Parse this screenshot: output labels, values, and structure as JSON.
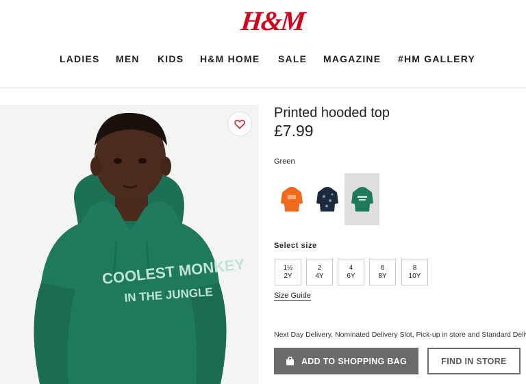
{
  "brand": {
    "logo_text": "H&M",
    "logo_color": "#d6001c"
  },
  "nav": {
    "items": [
      {
        "label": "LADIES"
      },
      {
        "label": "MEN"
      },
      {
        "label": "KIDS"
      },
      {
        "label": "H&M HOME"
      },
      {
        "label": "SALE"
      },
      {
        "label": "MAGAZINE"
      },
      {
        "label": "#HM GALLERY"
      }
    ]
  },
  "product": {
    "title": "Printed hooded top",
    "price": "£7.99",
    "favorite_icon": "heart-icon",
    "photo": {
      "print_line1": "COOLEST MONKEY",
      "print_line2": "IN THE JUNGLE",
      "hoodie_color": "#1f7a5c"
    },
    "color_label": "Green",
    "color_swatches": [
      {
        "name": "orange",
        "color": "#f06a1c",
        "selected": false
      },
      {
        "name": "navy",
        "color": "#1d2a3d",
        "selected": false
      },
      {
        "name": "green",
        "color": "#1f7a5c",
        "selected": true
      }
    ],
    "size_label": "Select size",
    "sizes": [
      {
        "line1": "1½",
        "line2": "2Y"
      },
      {
        "line1": "2",
        "line2": "4Y"
      },
      {
        "line1": "4",
        "line2": "6Y"
      },
      {
        "line1": "6",
        "line2": "8Y"
      },
      {
        "line1": "8",
        "line2": "10Y"
      }
    ],
    "size_guide": "Size Guide",
    "delivery_text": "Next Day Delivery, Nominated Delivery Slot, Pick-up in store and Standard Delivery",
    "add_to_bag_label": "ADD TO SHOPPING BAG",
    "add_to_bag_icon": "shopping-bag-icon",
    "find_in_store_label": "FIND IN STORE"
  }
}
